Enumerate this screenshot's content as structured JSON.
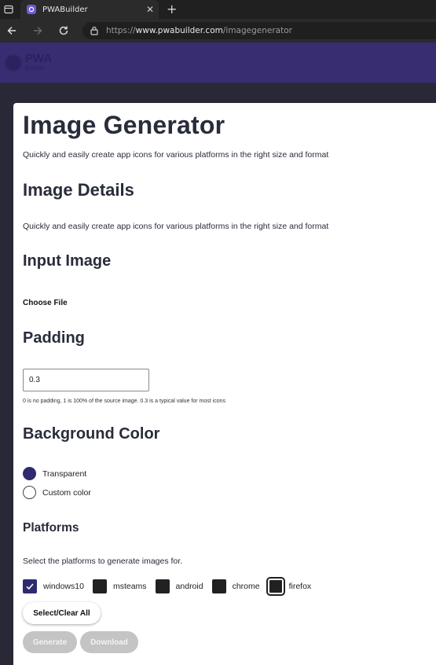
{
  "browser": {
    "tab_title": "PWABuilder",
    "url_prefix": "https://",
    "url_host": "www.pwabuilder.com",
    "url_path": "/imagegenerator"
  },
  "logo": {
    "line1": "PWA",
    "line2": "Builder"
  },
  "page": {
    "title": "Image Generator",
    "intro": "Quickly and easily create app icons for various platforms in the right size and format",
    "details_heading": "Image Details",
    "details_text": "Quickly and easily create app icons for various platforms in the right size and format",
    "input_heading": "Input Image",
    "choose_file_label": "Choose File",
    "padding_heading": "Padding",
    "padding_value": "0.3",
    "padding_hint": "0 is no padding, 1 is 100% of the source image. 0.3 is a typical value for most icons",
    "bg_heading": "Background Color",
    "bg_options": [
      {
        "label": "Transparent",
        "checked": true
      },
      {
        "label": "Custom color",
        "checked": false
      }
    ],
    "platforms_heading": "Platforms",
    "platforms_text": "Select the platforms to generate images for.",
    "platforms": [
      {
        "label": "windows10",
        "checked": true
      },
      {
        "label": "msteams",
        "checked": false
      },
      {
        "label": "android",
        "checked": false
      },
      {
        "label": "chrome",
        "checked": false
      },
      {
        "label": "firefox",
        "checked": false
      }
    ],
    "select_all_label": "Select/Clear All",
    "generate_label": "Generate",
    "download_label": "Download"
  },
  "colors": {
    "header_bg": "#372d70",
    "accent": "#2f2a6e",
    "page_bg": "#292837"
  }
}
